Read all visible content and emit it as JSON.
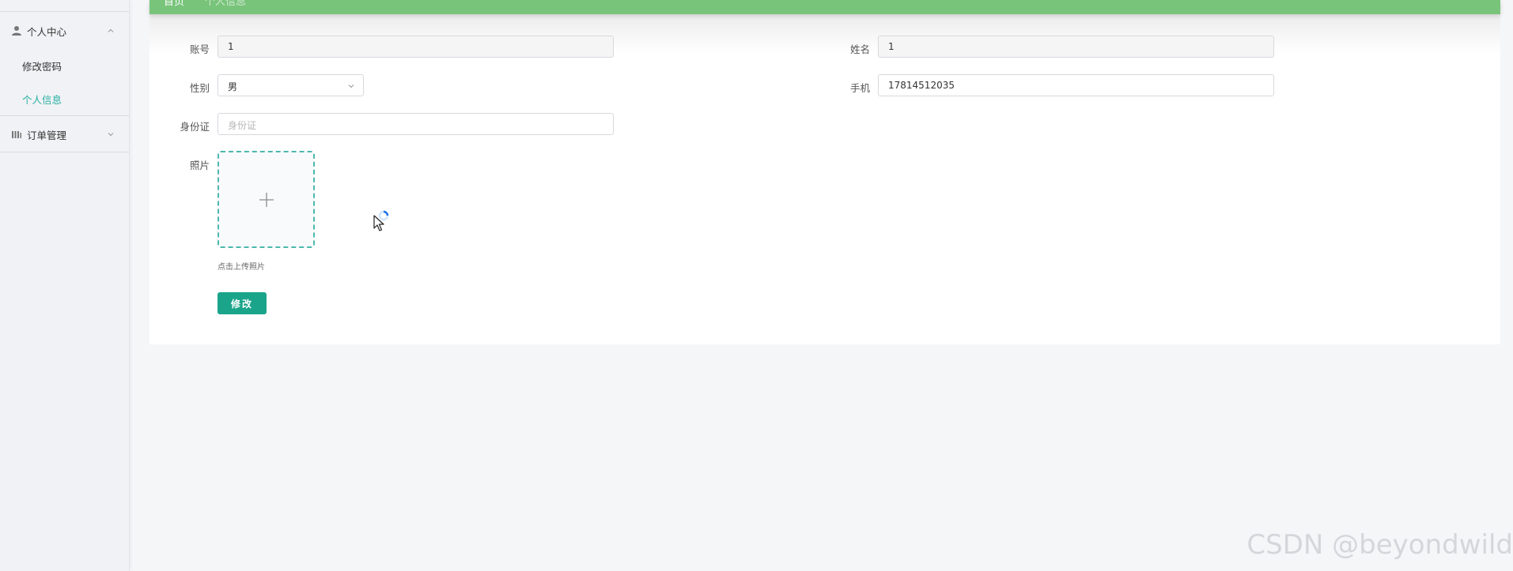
{
  "header": {
    "crumb_home": "首页",
    "crumb_current": "个人信息"
  },
  "sidebar": {
    "groups": [
      {
        "label": "个人中心",
        "icon": "user-icon",
        "expanded": true,
        "items": [
          {
            "label": "修改密码",
            "active": false
          },
          {
            "label": "个人信息",
            "active": true
          }
        ]
      },
      {
        "label": "订单管理",
        "icon": "bar-chart-icon",
        "expanded": false,
        "items": []
      }
    ]
  },
  "form": {
    "account_label": "账号",
    "account_value": "1",
    "name_label": "姓名",
    "name_value": "1",
    "gender_label": "性别",
    "gender_value": "男",
    "phone_label": "手机",
    "phone_value": "17814512035",
    "id_label": "身份证",
    "id_placeholder": "身份证",
    "photo_label": "照片",
    "upload_hint": "点击上传照片",
    "submit_label": "修改"
  },
  "colors": {
    "accent": "#27b0a4",
    "header_green": "#79c47b",
    "button": "#1aa58a"
  },
  "watermark": "CSDN @beyondwild"
}
